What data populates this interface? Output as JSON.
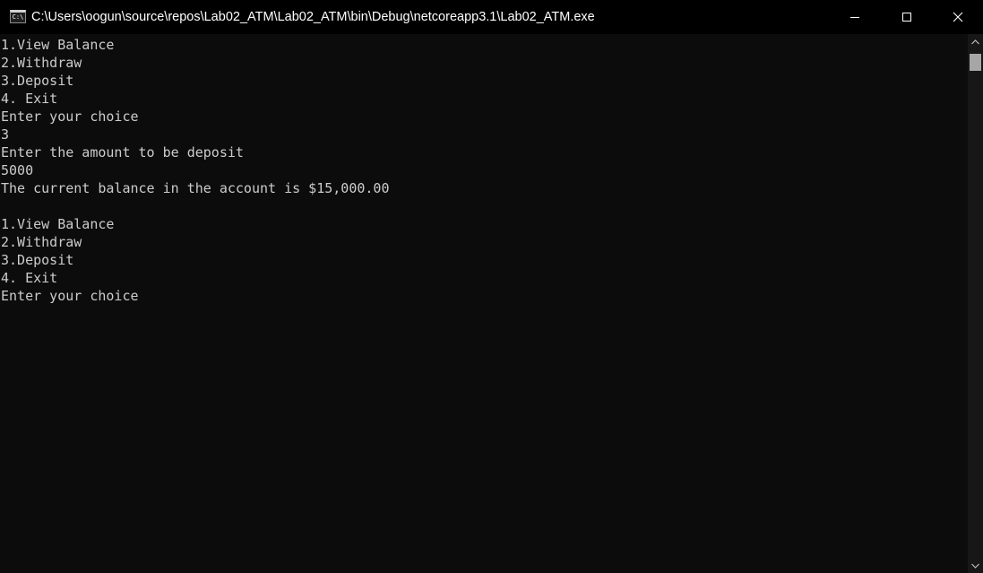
{
  "window": {
    "title": "C:\\Users\\oogun\\source\\repos\\Lab02_ATM\\Lab02_ATM\\bin\\Debug\\netcoreapp3.1\\Lab02_ATM.exe",
    "icon_label": "C:\\",
    "icon": "console-icon",
    "buttons": {
      "minimize": "minimize-icon",
      "maximize": "maximize-icon",
      "close": "close-icon"
    }
  },
  "console": {
    "lines": [
      "1.View Balance",
      "2.Withdraw",
      "3.Deposit",
      "4. Exit",
      "Enter your choice",
      "3",
      "Enter the amount to be deposit",
      "5000",
      "The current balance in the account is $15,000.00",
      "",
      "1.View Balance",
      "2.Withdraw",
      "3.Deposit",
      "4. Exit",
      "Enter your choice"
    ]
  },
  "colors": {
    "background": "#0c0c0c",
    "text": "#cccccc",
    "titlebar": "#000000"
  }
}
